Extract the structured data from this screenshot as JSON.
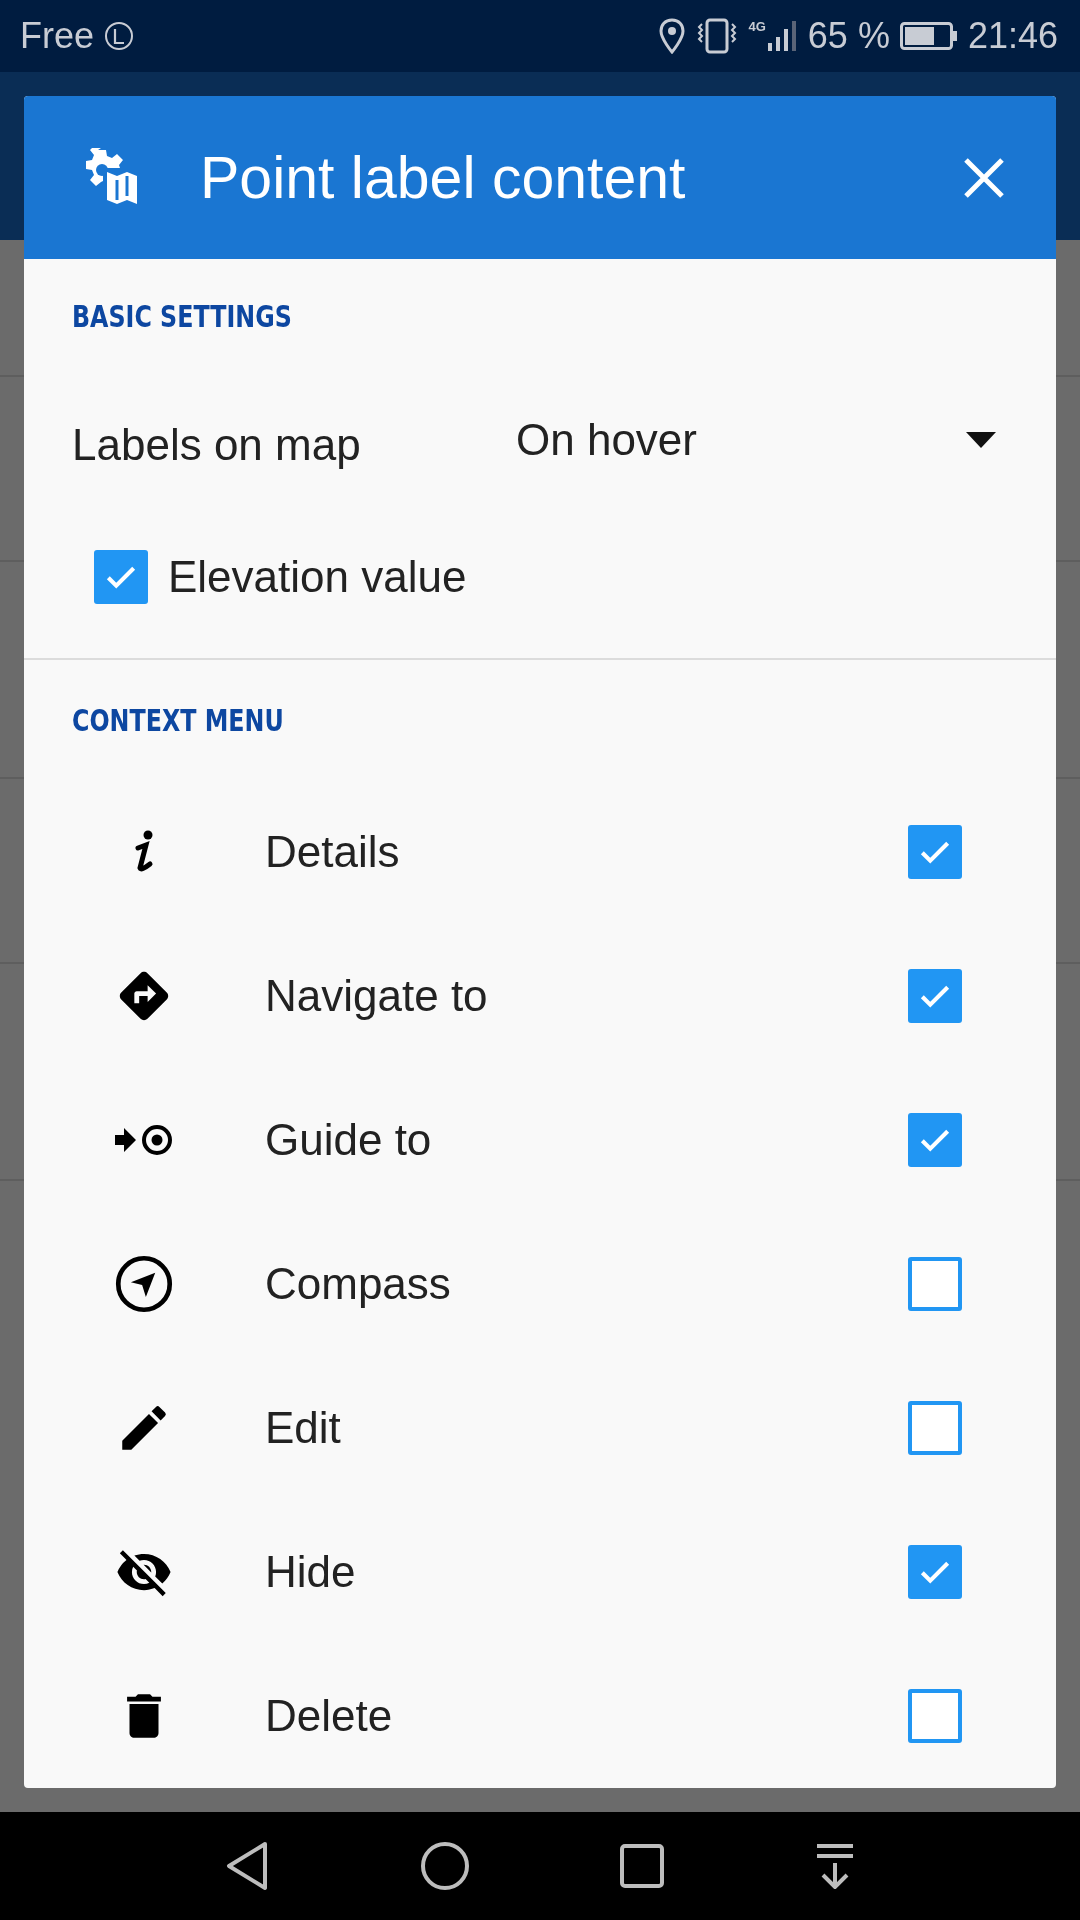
{
  "status_bar": {
    "carrier": "Free",
    "network": "4G",
    "battery": "65 %",
    "time": "21:46"
  },
  "dialog": {
    "title": "Point label content",
    "basic_settings": {
      "heading": "BASIC SETTINGS",
      "labels_on_map": {
        "label": "Labels on map",
        "value": "On hover"
      },
      "elevation": {
        "label": "Elevation value",
        "checked": true
      }
    },
    "context_menu": {
      "heading": "CONTEXT MENU",
      "items": [
        {
          "label": "Details",
          "checked": true
        },
        {
          "label": "Navigate to",
          "checked": true
        },
        {
          "label": "Guide to",
          "checked": true
        },
        {
          "label": "Compass",
          "checked": false
        },
        {
          "label": "Edit",
          "checked": false
        },
        {
          "label": "Hide",
          "checked": true
        },
        {
          "label": "Delete",
          "checked": false
        }
      ]
    }
  }
}
